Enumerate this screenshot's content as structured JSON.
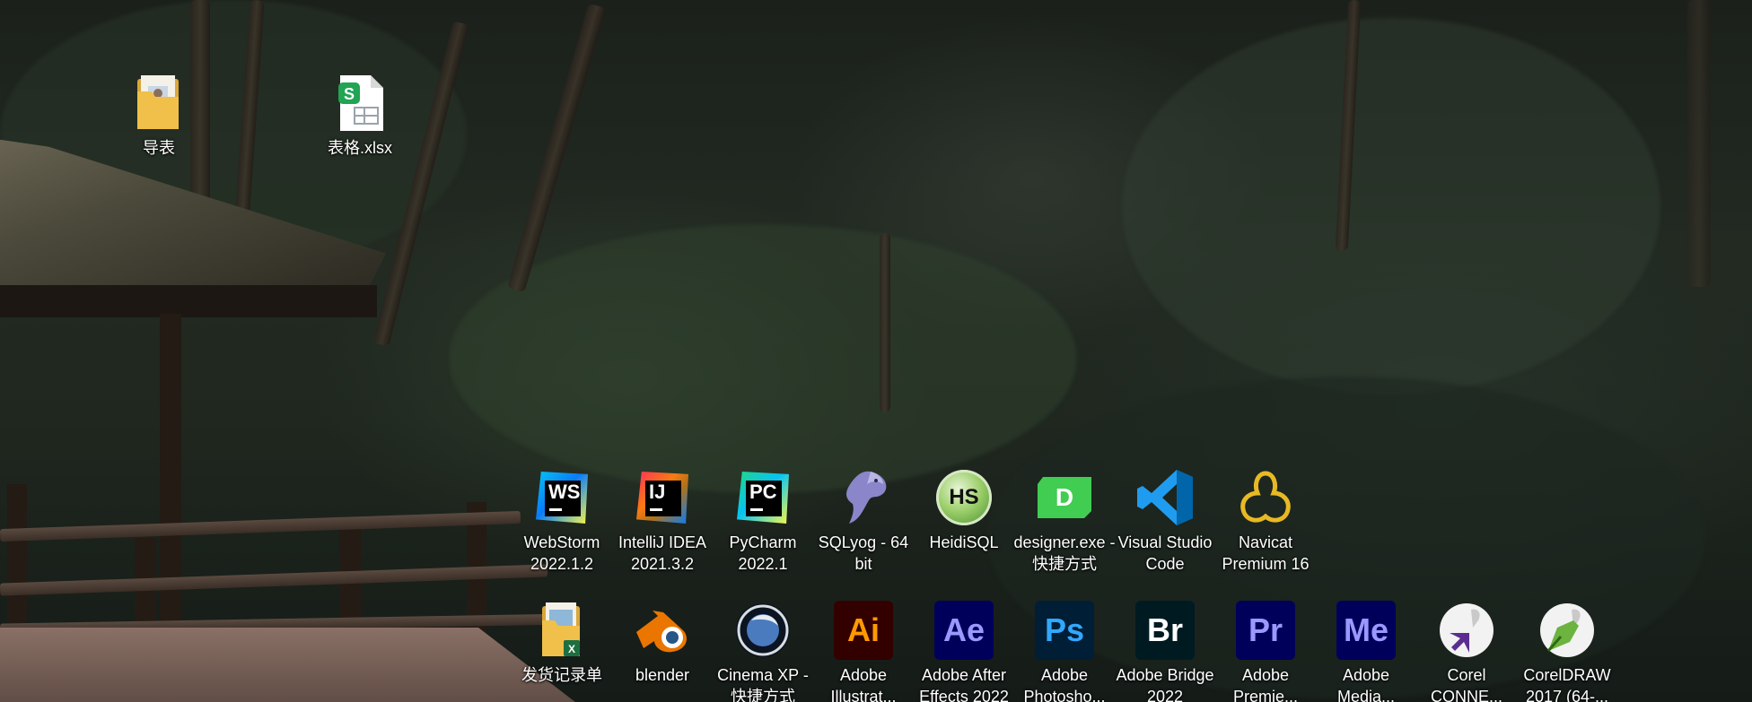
{
  "desktop": {
    "top_icons": [
      {
        "label": "导表",
        "icon": "folder-icon"
      },
      {
        "label": "表格.xlsx",
        "icon": "spreadsheet-file-icon"
      }
    ],
    "row1_icons": [
      {
        "label": "WebStorm 2022.1.2",
        "icon": "webstorm-icon",
        "code": "WS"
      },
      {
        "label": "IntelliJ IDEA 2021.3.2",
        "icon": "intellij-idea-icon",
        "code": "IJ"
      },
      {
        "label": "PyCharm 2022.1",
        "icon": "pycharm-icon",
        "code": "PC"
      },
      {
        "label": "SQLyog - 64 bit",
        "icon": "sqlyog-dolphin-icon"
      },
      {
        "label": "HeidiSQL",
        "icon": "heidisql-icon",
        "code": "HS"
      },
      {
        "label": "designer.exe - 快捷方式",
        "icon": "qt-designer-icon",
        "code": "D"
      },
      {
        "label": "Visual Studio Code",
        "icon": "vscode-icon"
      },
      {
        "label": "Navicat Premium 16",
        "icon": "navicat-icon"
      }
    ],
    "row2_icons": [
      {
        "label": "发货记录单",
        "icon": "excel-folder-icon"
      },
      {
        "label": "blender",
        "icon": "blender-icon"
      },
      {
        "label": "Cinema XP - 快捷方式",
        "icon": "cinema4d-icon"
      },
      {
        "label": "Adobe Illustrat...",
        "icon": "illustrator-icon",
        "code": "Ai",
        "bg": "#330000",
        "fg": "#ff9a00"
      },
      {
        "label": "Adobe After Effects 2022",
        "icon": "after-effects-icon",
        "code": "Ae",
        "bg": "#00005b",
        "fg": "#9999ff"
      },
      {
        "label": "Adobe Photosho...",
        "icon": "photoshop-icon",
        "code": "Ps",
        "bg": "#001e36",
        "fg": "#31a8ff"
      },
      {
        "label": "Adobe Bridge 2022",
        "icon": "bridge-icon",
        "code": "Br",
        "bg": "#001a22",
        "fg": "#ffffff"
      },
      {
        "label": "Adobe Premie...",
        "icon": "premiere-icon",
        "code": "Pr",
        "bg": "#00005b",
        "fg": "#9999ff"
      },
      {
        "label": "Adobe Media...",
        "icon": "media-encoder-icon",
        "code": "Me",
        "bg": "#00005b",
        "fg": "#9999ff"
      },
      {
        "label": "Corel CONNE...",
        "icon": "corel-connect-icon"
      },
      {
        "label": "CorelDRAW 2017 (64-...",
        "icon": "coreldraw-icon"
      }
    ]
  }
}
